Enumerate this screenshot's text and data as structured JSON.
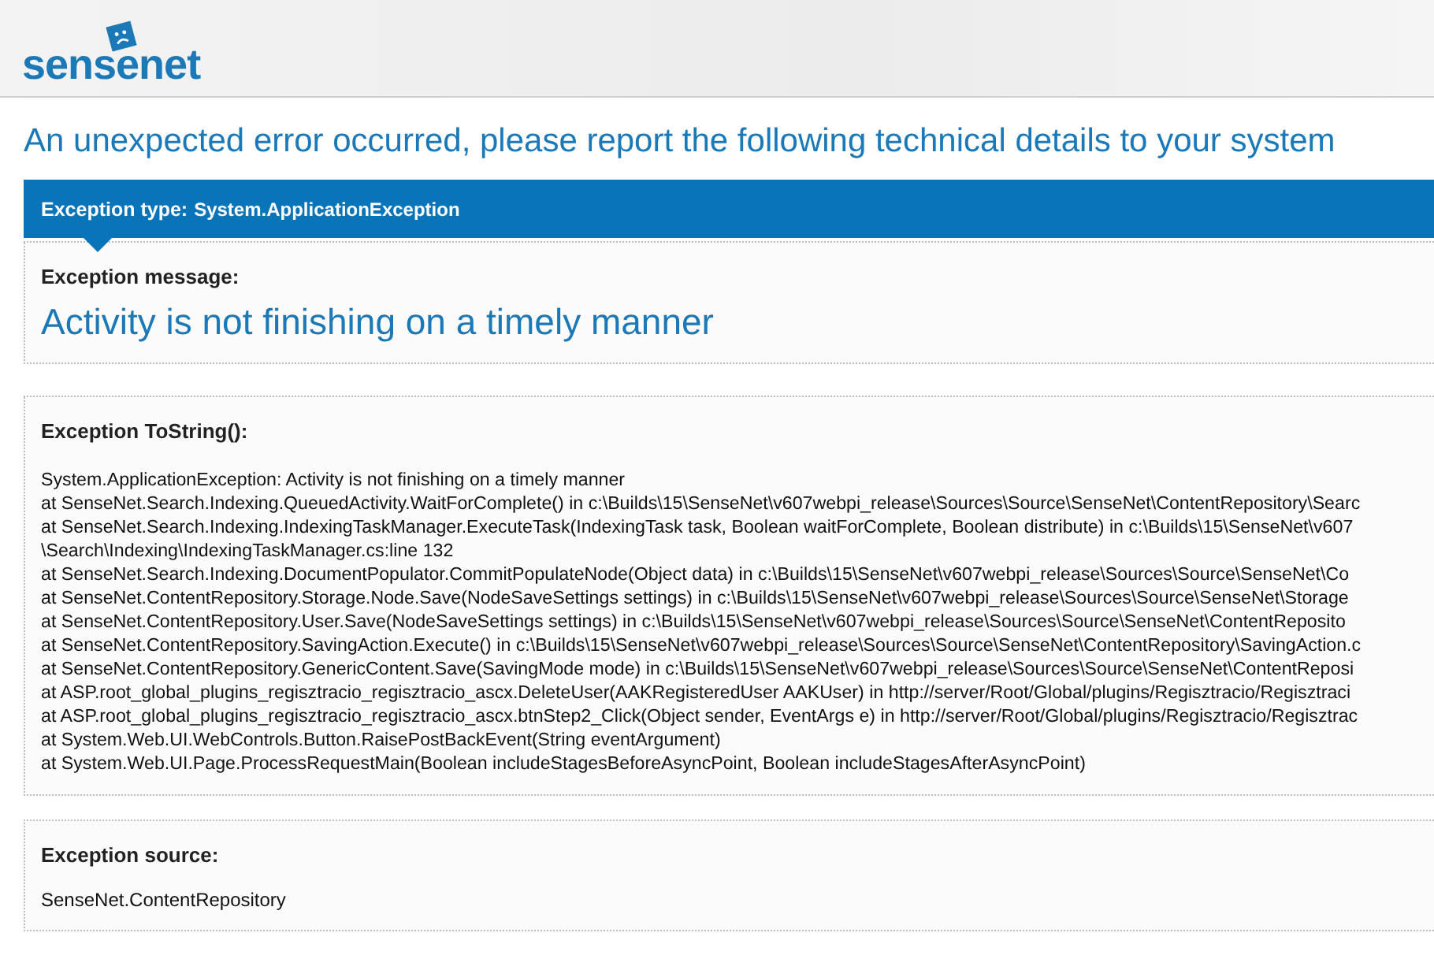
{
  "header": {
    "logo_text": "sensenet"
  },
  "heading": "An unexpected error occurred, please report the following technical details to your system",
  "exception_type": {
    "label": "Exception type:",
    "value": "System.ApplicationException"
  },
  "sections": [
    {
      "kind": "message",
      "title": "Exception message:",
      "lines": [
        "Activity is not finishing on a timely manner"
      ]
    },
    {
      "kind": "trace",
      "title": "Exception ToString():",
      "lines": [
        "System.ApplicationException: Activity is not finishing on a timely manner",
        "at SenseNet.Search.Indexing.QueuedActivity.WaitForComplete() in c:\\Builds\\15\\SenseNet\\v607webpi_release\\Sources\\Source\\SenseNet\\ContentRepository\\Searc",
        "at SenseNet.Search.Indexing.IndexingTaskManager.ExecuteTask(IndexingTask task, Boolean waitForComplete, Boolean distribute) in c:\\Builds\\15\\SenseNet\\v607",
        "\\Search\\Indexing\\IndexingTaskManager.cs:line 132",
        "at SenseNet.Search.Indexing.DocumentPopulator.CommitPopulateNode(Object data) in c:\\Builds\\15\\SenseNet\\v607webpi_release\\Sources\\Source\\SenseNet\\Co",
        "at SenseNet.ContentRepository.Storage.Node.Save(NodeSaveSettings settings) in c:\\Builds\\15\\SenseNet\\v607webpi_release\\Sources\\Source\\SenseNet\\Storage",
        "at SenseNet.ContentRepository.User.Save(NodeSaveSettings settings) in c:\\Builds\\15\\SenseNet\\v607webpi_release\\Sources\\Source\\SenseNet\\ContentReposito",
        "at SenseNet.ContentRepository.SavingAction.Execute() in c:\\Builds\\15\\SenseNet\\v607webpi_release\\Sources\\Source\\SenseNet\\ContentRepository\\SavingAction.c",
        "at SenseNet.ContentRepository.GenericContent.Save(SavingMode mode) in c:\\Builds\\15\\SenseNet\\v607webpi_release\\Sources\\Source\\SenseNet\\ContentReposi",
        "at ASP.root_global_plugins_regisztracio_regisztracio_ascx.DeleteUser(AAKRegisteredUser AAKUser) in http://server/Root/Global/plugins/Regisztracio/Regisztraci",
        "at ASP.root_global_plugins_regisztracio_regisztracio_ascx.btnStep2_Click(Object sender, EventArgs e) in http://server/Root/Global/plugins/Regisztracio/Regisztrac",
        "at System.Web.UI.WebControls.Button.RaisePostBackEvent(String eventArgument)",
        "at System.Web.UI.Page.ProcessRequestMain(Boolean includeStagesBeforeAsyncPoint, Boolean includeStagesAfterAsyncPoint)"
      ]
    },
    {
      "kind": "source",
      "title": "Exception source:",
      "lines": [
        "SenseNet.ContentRepository"
      ]
    }
  ]
}
